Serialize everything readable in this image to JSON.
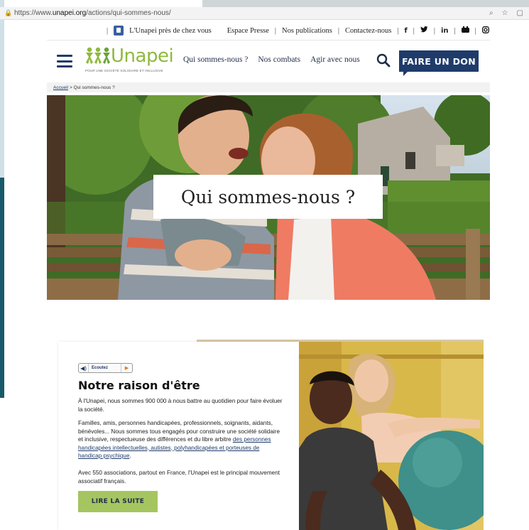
{
  "browser": {
    "url_prefix": "https://www.",
    "url_host": "unapei.org",
    "url_path": "/actions/qui-sommes-nous/",
    "zoom_icon": "magnifier-icon",
    "star_icon": "star-icon",
    "extra_icon": "window-icon"
  },
  "utility": {
    "near_you": "L'Unapei près de chez vous",
    "press": "Espace Presse",
    "publications": "Nos publications",
    "contact": "Contactez-nous",
    "socials": [
      "f",
      "🐦",
      "in",
      "▶",
      "◎"
    ]
  },
  "header": {
    "logo_word": "Unapei",
    "logo_tagline": "POUR UNE SOCIÉTÉ SOLIDAIRE ET INCLUSIVE",
    "nav": [
      "Qui sommes-nous ?",
      "Nos combats",
      "Agir avec nous"
    ],
    "donate": "FAIRE UN DON"
  },
  "breadcrumb": {
    "home": "Accueil",
    "current": "> Qui sommes-nous ?"
  },
  "hero": {
    "title": "Qui sommes-nous ?"
  },
  "card": {
    "listen": "Ecoutez",
    "heading": "Notre raison d'être",
    "p1": "À l'Unapei, nous sommes 900 000 à nous battre au quotidien pour faire évoluer la société.",
    "p2_text": "Familles, amis, personnes handicapées, professionnels, soignants, aidants, bénévoles... Nous sommes tous engagés pour construire une société solidaire et inclusive, respectueuse des différences et du libre arbitre ",
    "p2_link": "des personnes handicapées intellectuelles, autistes, polyhandicapées et porteuses de handicap psychique",
    "p2_end": ".",
    "p3": "Avec 550 associations, partout en France, l'Unapei est le principal mouvement associatif français.",
    "read_more": "LIRE LA SUITE"
  },
  "colors": {
    "navy": "#1f3b6a",
    "green": "#8fb93e",
    "button_green": "#a5c560"
  }
}
